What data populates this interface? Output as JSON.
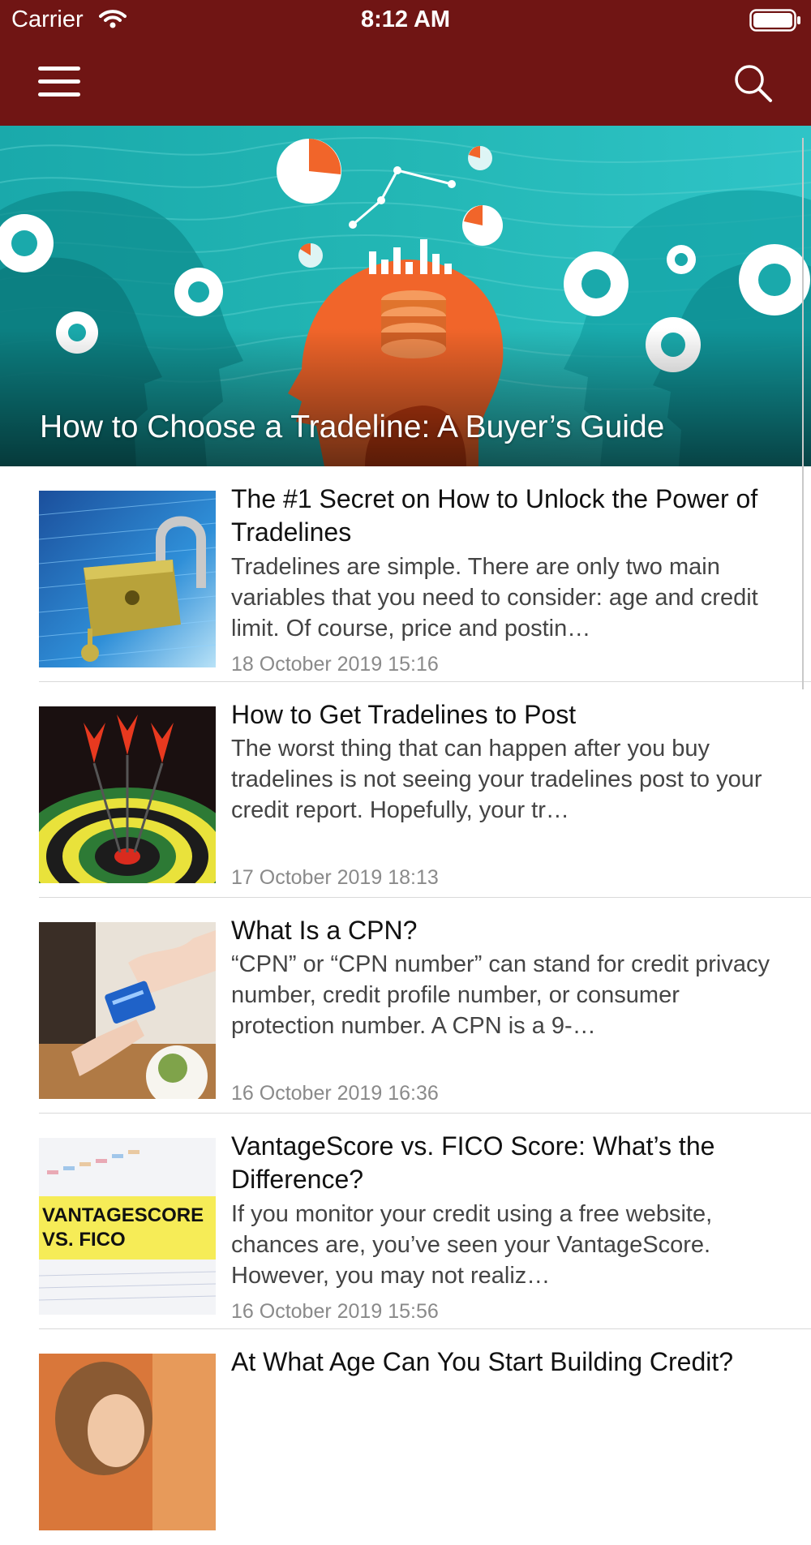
{
  "status_bar": {
    "carrier": "Carrier",
    "time": "8:12 AM"
  },
  "nav": {
    "menu_icon": "hamburger-menu-icon",
    "search_icon": "search-icon",
    "bar_color": "#701514"
  },
  "featured": {
    "title": "How to Choose a Tradeline: A Buyer’s Guide"
  },
  "articles": [
    {
      "title": "The #1 Secret on How to Unlock the Power of Tradelines",
      "excerpt": "Tradelines are simple. There are only two main variables that you need to consider: age and credit limit. Of course, price and postin…",
      "date": "18 October 2019 15:16",
      "thumbnail": "padlock-image"
    },
    {
      "title": "How to Get Tradelines to Post",
      "excerpt": "The worst thing that can happen after you buy tradelines is not seeing your tradelines post to your credit report. Hopefully, your tr…",
      "date": "17 October 2019 18:13",
      "thumbnail": "darts-target-image"
    },
    {
      "title": "What Is a CPN?",
      "excerpt": "“CPN” or “CPN number” can stand for credit privacy number, credit profile number, or consumer protection number. A CPN is a 9-…",
      "date": "16 October 2019 16:36",
      "thumbnail": "credit-card-payment-image"
    },
    {
      "title": "VantageScore vs. FICO Score: What’s the Difference?",
      "excerpt": "If you monitor your credit using a free website, chances are, you’ve seen your VantageScore. However, you may not realiz…",
      "date": "16 October 2019 15:56",
      "thumbnail": "vantagescore-vs-fico-image",
      "thumbnail_text_1": "VANTAGESCORE",
      "thumbnail_text_2": "VS. FICO"
    },
    {
      "title": "At What Age Can You Start Building Credit?",
      "excerpt": "",
      "date": "",
      "thumbnail": "child-image"
    }
  ]
}
